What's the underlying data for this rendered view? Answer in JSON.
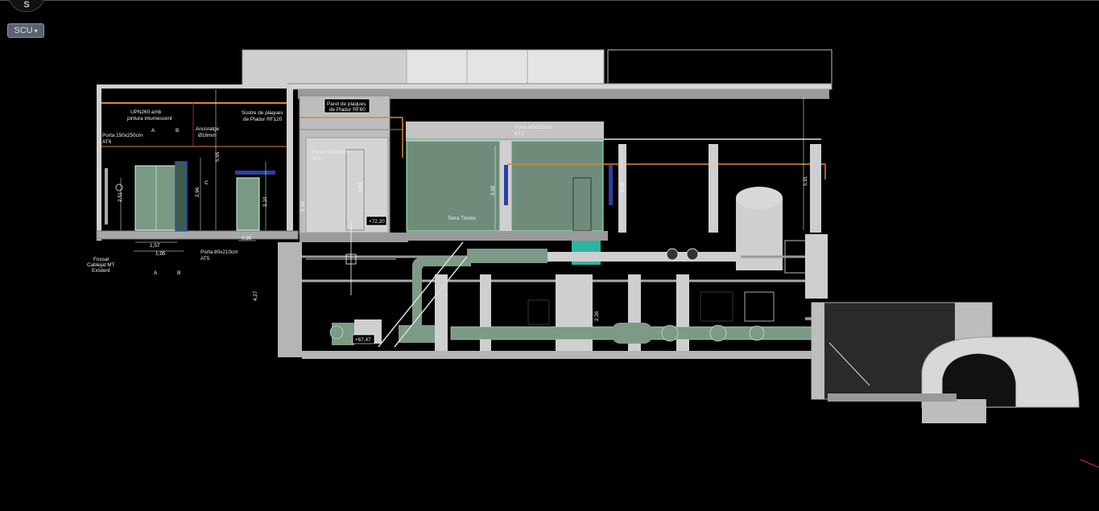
{
  "viewcube": {
    "compass_letter": "S"
  },
  "ucs": {
    "label": "SCU",
    "caret": "▾"
  },
  "annotations": {
    "upn": [
      "UPN260 amb",
      "pintura intumescent"
    ],
    "porta_at6": [
      "Porta 150x250cm",
      "AT6"
    ],
    "ancoratge": [
      "Ancoratge",
      "Ø16mm"
    ],
    "sostre": [
      "Sostre de plaques",
      "de Pladur RF120"
    ],
    "paret": [
      "Paret de plaques",
      "de Pladur RF60"
    ],
    "porta_at4": [
      "Porta 70x210cm",
      "AT4"
    ],
    "porta_bt1": [
      "Porta 90x215cm",
      "BT1"
    ],
    "terra": "Terra Tècnic",
    "fossat": [
      "Fossat",
      "Cablejat MT",
      "Existent"
    ],
    "porta_at5": [
      "Porta 80x210cm",
      "AT5"
    ],
    "level_1": "+72,20",
    "level_2": "+67,47"
  },
  "dimensions": {
    "d_565": "5,65",
    "d_251": "2,51",
    "d_296": "2,96",
    "d_210a": "2,10",
    "d_210b": "2,10",
    "d_353": "3,53",
    "d_360": "3,60",
    "d_330": "3,30",
    "d_691": "6,91",
    "d_427": "4,27",
    "d_236": "2,36",
    "d_157": "1,57",
    "d_195": "1,95",
    "d_080": "0,80"
  },
  "section_marks": {
    "a": "A",
    "b": "B",
    "c": "C"
  }
}
